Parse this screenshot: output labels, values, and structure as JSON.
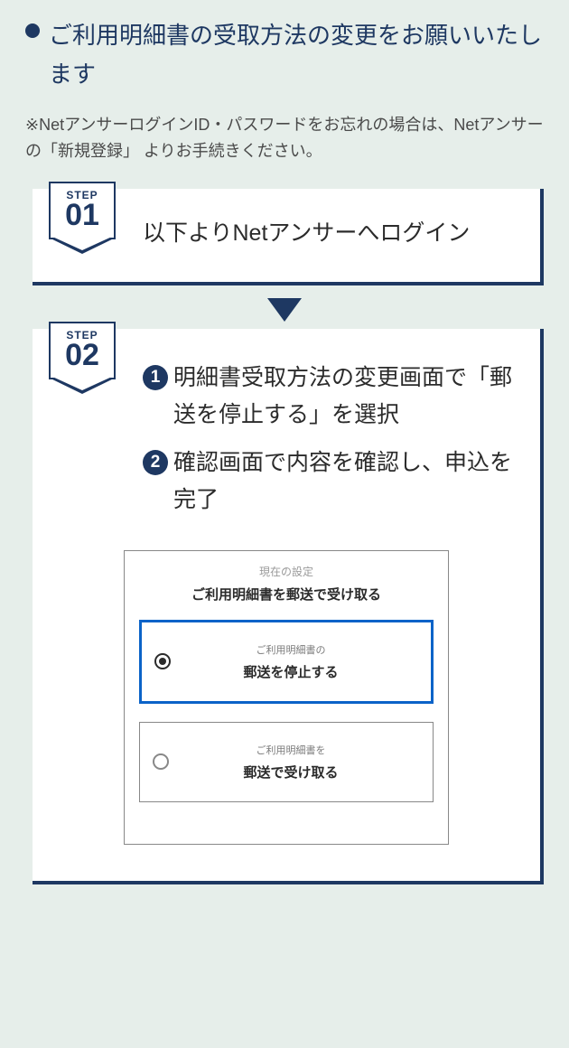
{
  "heading": "ご利用明細書の受取方法の変更をお願いいたします",
  "note": "※NetアンサーログインID・パスワードをお忘れの場合は、Netアンサーの「新規登録」 よりお手続きください。",
  "step_label": "STEP",
  "step1": {
    "num": "01",
    "text": "以下よりNetアンサーへログイン"
  },
  "step2": {
    "num": "02",
    "items": [
      {
        "num": "1",
        "text": "明細書受取方法の変更画面で「郵送を停止する」を選択"
      },
      {
        "num": "2",
        "text": "確認画面で内容を確認し、申込を完了"
      }
    ]
  },
  "screenshot": {
    "current_label": "現在の設定",
    "current_setting": "ご利用明細書を郵送で受け取る",
    "option_a": {
      "sub": "ご利用明細書の",
      "main": "郵送を停止する"
    },
    "option_b": {
      "sub": "ご利用明細書を",
      "main": "郵送で受け取る"
    }
  }
}
